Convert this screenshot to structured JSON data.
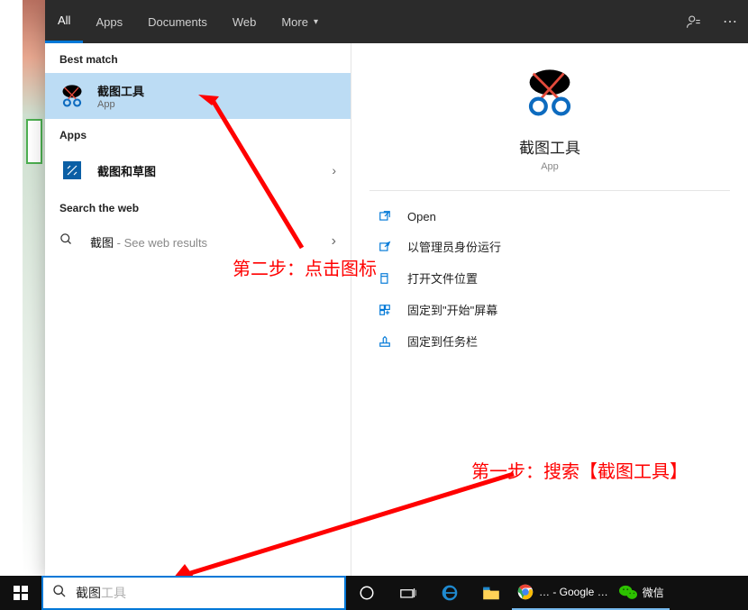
{
  "tabs": {
    "all": "All",
    "apps": "Apps",
    "documents": "Documents",
    "web": "Web",
    "more": "More"
  },
  "left": {
    "best_match_label": "Best match",
    "best_match": {
      "title": "截图工具",
      "kind": "App"
    },
    "apps_label": "Apps",
    "apps": [
      {
        "title": "截图和草图"
      }
    ],
    "search_web_label": "Search the web",
    "web_term": "截图",
    "web_suffix": " - See web results"
  },
  "preview": {
    "name": "截图工具",
    "kind": "App",
    "actions": {
      "open": "Open",
      "run_admin": "以管理员身份运行",
      "open_location": "打开文件位置",
      "pin_start": "固定到\"开始\"屏幕",
      "pin_taskbar": "固定到任务栏"
    }
  },
  "annotations": {
    "step2": "第二步：点击图标",
    "step1": "第一步：搜索【截图工具】"
  },
  "search": {
    "typed": "截图",
    "suggestion_tail": "工具"
  },
  "taskbar": {
    "chrome_title": "… - Google …",
    "wechat": "微信"
  }
}
